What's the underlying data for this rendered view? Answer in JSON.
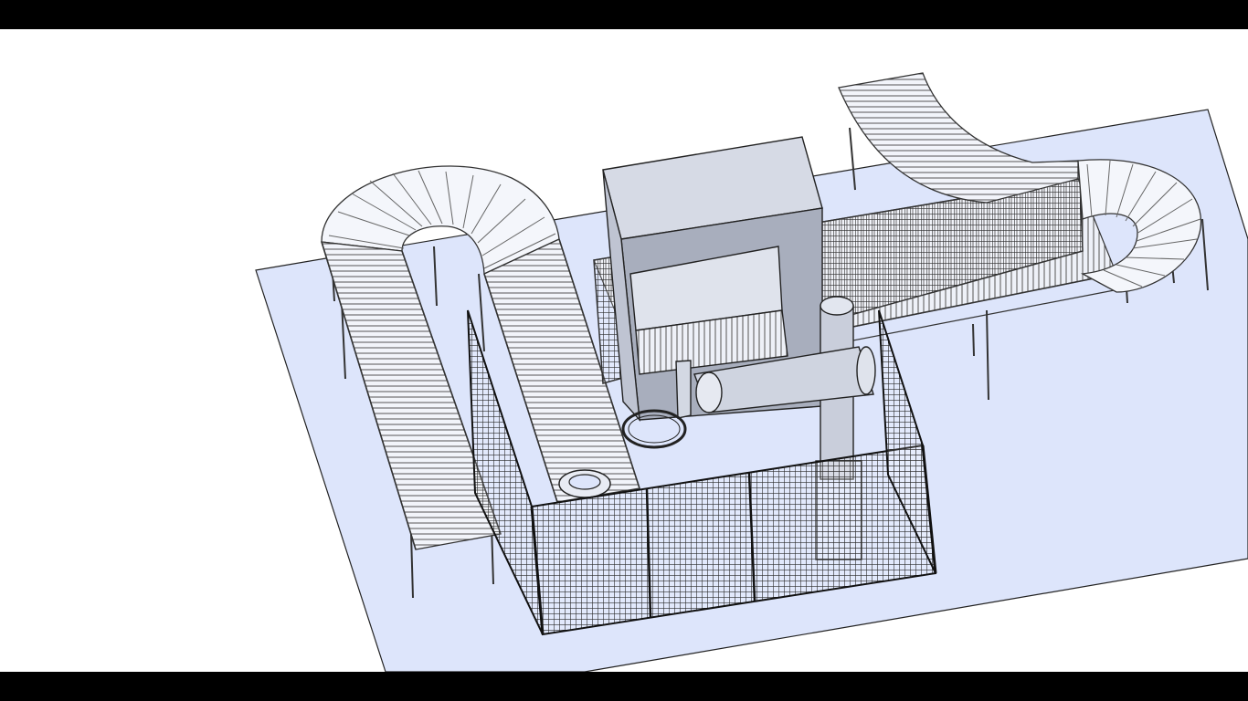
{
  "viewer": {
    "mode": "3d-model-view",
    "letterbox_color": "#000000",
    "background_color": "#ffffff"
  },
  "model": {
    "floor_color": "#dde5fb",
    "metal_color": "#ffffff",
    "machine_color": "#c7ccd9",
    "edge_color": "#1a1a1a",
    "mesh_color": "#333333"
  }
}
